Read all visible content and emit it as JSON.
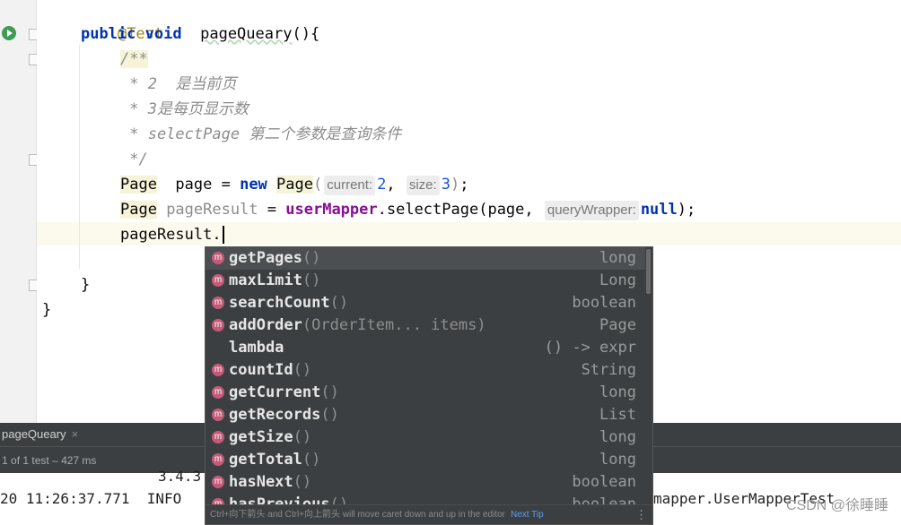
{
  "code": {
    "annotation": "@Test",
    "kw_public": "public",
    "kw_void": "void",
    "method_name": "pageQueary",
    "open_sig": "(){",
    "comment_open": "/**",
    "comment_line1": " * 2  是当前页",
    "comment_line2": " * 3是每页显示数",
    "comment_line3": " * selectPage 第二个参数是查询条件",
    "comment_close": " */",
    "line_page_type": "Page",
    "line_page_var": "  page = ",
    "kw_new": "new",
    "page_ctor": "Page",
    "hint_current": "current:",
    "current_value": "2",
    "hint_size": "size:",
    "size_value": "3",
    "line2_type": "Page",
    "line2_var": " pageResult",
    "line2_eq": " = ",
    "mapper_field": "userMapper",
    "select_call": ".selectPage",
    "line2_arg": "(page, ",
    "hint_query": "queryWrapper:",
    "kw_null": "null",
    "line2_end": ");",
    "typing": "pageResult.",
    "close_method": "}",
    "close_class": "}"
  },
  "completion": {
    "items": [
      {
        "name": "getPages",
        "params": "()",
        "type": "long",
        "icon": "m"
      },
      {
        "name": "maxLimit",
        "params": "()",
        "type": "Long",
        "icon": "m"
      },
      {
        "name": "searchCount",
        "params": "()",
        "type": "boolean",
        "icon": "m"
      },
      {
        "name": "addOrder",
        "params": "(OrderItem... items)",
        "type": "Page",
        "icon": "m"
      },
      {
        "name": "lambda",
        "params": "",
        "type": "() -> expr",
        "icon": ""
      },
      {
        "name": "countId",
        "params": "()",
        "type": "String",
        "icon": "m"
      },
      {
        "name": "getCurrent",
        "params": "()",
        "type": "long",
        "icon": "m"
      },
      {
        "name": "getRecords",
        "params": "()",
        "type": "List",
        "icon": "m"
      },
      {
        "name": "getSize",
        "params": "()",
        "type": "long",
        "icon": "m"
      },
      {
        "name": "getTotal",
        "params": "()",
        "type": "long",
        "icon": "m"
      },
      {
        "name": "hasNext",
        "params": "()",
        "type": "boolean",
        "icon": "m"
      },
      {
        "name": "hasPrevious",
        "params": "()",
        "type": "boolean",
        "icon": "m"
      }
    ],
    "footer_hint": "Ctrl+向下箭头 and Ctrl+向上箭头 will move caret down and up in the editor",
    "next_tip": "Next Tip",
    "more_icon": "⋮"
  },
  "run": {
    "tab_label": "pageQueary",
    "tab_close": "×",
    "status": "of 1 test – 427 ms",
    "status_prefix": "1",
    "console_line1": "3.4.3",
    "console_line2": "20 11:26:37.771  INFO",
    "console_line2_tail": "mapper.UserMapperTest"
  },
  "watermark": "CSDN @徐睡睡"
}
